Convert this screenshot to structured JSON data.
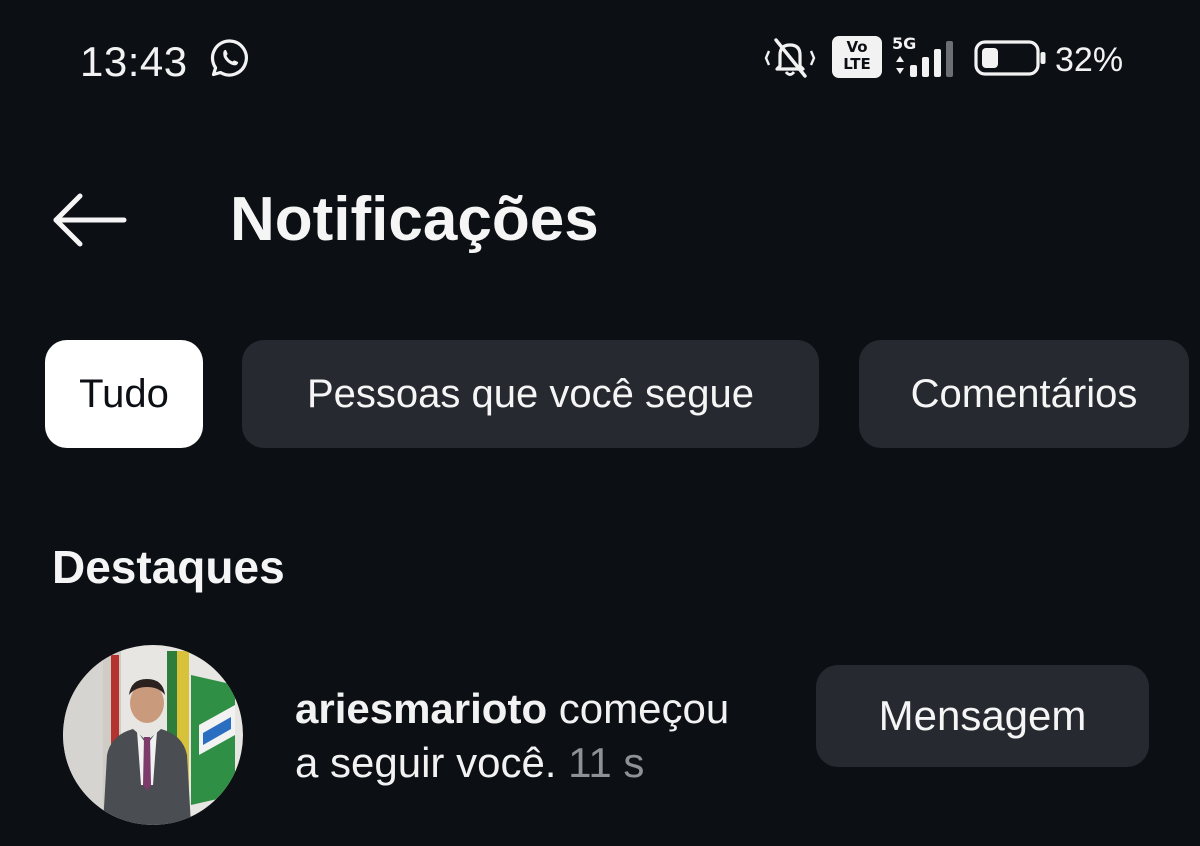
{
  "status_bar": {
    "time": "13:43",
    "network": "5G",
    "volte": [
      "Vo",
      "LTE"
    ],
    "battery_percent": "32%",
    "battery_level": 0.32,
    "icons": [
      "whatsapp-icon",
      "mute-icon",
      "volte-icon",
      "signal-icon",
      "battery-icon"
    ]
  },
  "header": {
    "title": "Notificações",
    "back_icon": "arrow-left-icon"
  },
  "filters": [
    {
      "label": "Tudo",
      "active": true
    },
    {
      "label": "Pessoas que você segue",
      "active": false
    },
    {
      "label": "Comentários",
      "active": false
    }
  ],
  "section": {
    "title": "Destaques"
  },
  "notification": {
    "username": "ariesmarioto",
    "text_part1": " começou",
    "text_part2": "a seguir você.",
    "time": "11 s",
    "button_label": "Mensagem"
  },
  "colors": {
    "background": "#0c0f14",
    "chip_background": "#26292f",
    "chip_active_background": "#ffffff",
    "muted_text": "#8e9196"
  }
}
